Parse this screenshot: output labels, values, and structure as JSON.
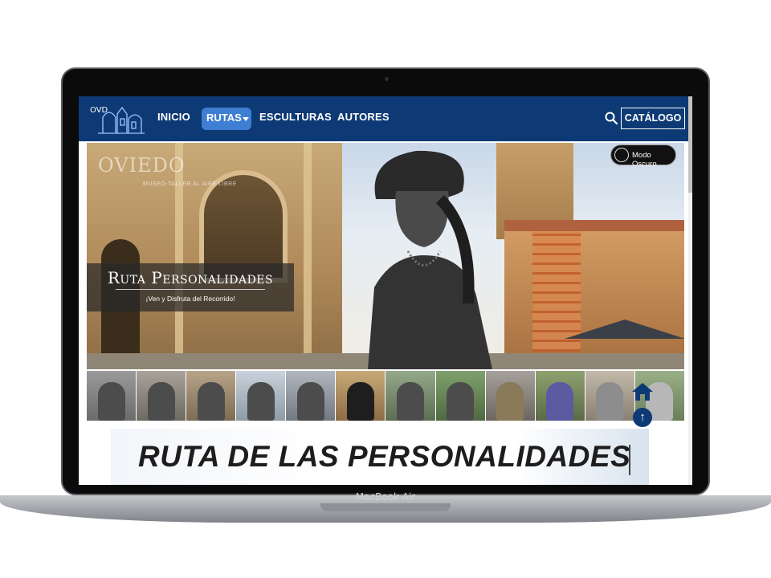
{
  "device": {
    "label": "MacBook Air"
  },
  "nav": {
    "items": [
      {
        "label": "INICIO"
      },
      {
        "label": "RUTAS"
      },
      {
        "label": "ESCULTURAS"
      },
      {
        "label": "AUTORES"
      }
    ],
    "catalog_label": "CATÁLOGO",
    "logo_text": "OVD"
  },
  "hero": {
    "logo_text": "OVIEDO",
    "logo_subtitle": "MUSEO-TALLER AL AIRE LIBRE",
    "dark_mode_label": "Modo Oscuro",
    "title": "Ruta Personalidades",
    "subtitle": "¡Ven y Disfruta del Recorrido!"
  },
  "thumbnails": {
    "count": 12
  },
  "section": {
    "title": "RUTA DE LAS PERSONALIDADES"
  },
  "colors": {
    "nav_bg": "#0d3a74",
    "nav_active": "#3e7ed3",
    "overlay_bg": "rgba(40,40,40,.72)"
  },
  "icons": [
    "search-icon",
    "home-icon",
    "arrow-up-icon",
    "dark-mode-icon",
    "caret-down-icon"
  ]
}
